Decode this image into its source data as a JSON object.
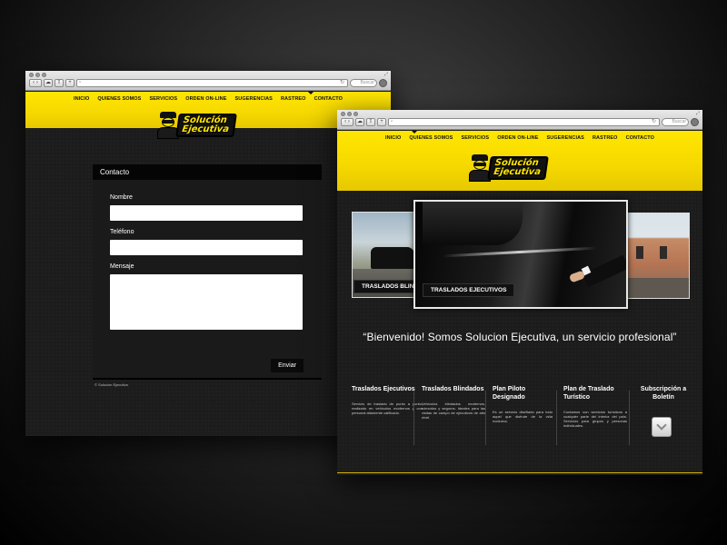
{
  "nav": [
    "INICIO",
    "QUIENES SOMOS",
    "SERVICIOS",
    "ORDEN ON-LINE",
    "SUGERENCIAS",
    "RASTREO",
    "CONTACTO"
  ],
  "browser": {
    "search_placeholder": "Buscar"
  },
  "logo": {
    "line1": "Solución",
    "line2": "Ejecutiva"
  },
  "contact_page": {
    "active_nav": "CONTACTO",
    "heading": "Contacto",
    "name_label": "Nombre",
    "phone_label": "Teléfono",
    "message_label": "Mensaje",
    "submit_label": "Enviar",
    "copyright": "© Solucion Ejecutiva"
  },
  "home_page": {
    "active_nav": "INICIO",
    "slider_captions": [
      "TRASLADOS BLINDADOS",
      "TRASLADOS EJECUTIVOS"
    ],
    "welcome": "“Bienvenido! Somos Solucion Ejecutiva, un servicio profesional”",
    "services": [
      {
        "title": "Traslados Ejecutivos",
        "description": "Servicio de traslado de punto a punto, realizado en vehículos modernos y con personal altamente calificado."
      },
      {
        "title": "Traslados Blindados",
        "description": "Vehículos blindados modernos, cómodos y seguros. Ideales para las visitas de campo de ejecutivos de alto nivel."
      },
      {
        "title": "Plan Piloto Designado",
        "description": "Es un servicio diseñado para todo aquel que disfrute de la vida nocturna."
      },
      {
        "title": "Plan de Traslado Turístico",
        "description": "Contamos con servicios turísticos a cualquier parte del interior del país. Servicios para grupos y personas individuales."
      },
      {
        "title": "Subscripción a Boletín",
        "description": ""
      }
    ]
  },
  "colors": {
    "brand_yellow": "#ffe600",
    "background_dark": "#1c1c1c",
    "text_white": "#ffffff"
  }
}
